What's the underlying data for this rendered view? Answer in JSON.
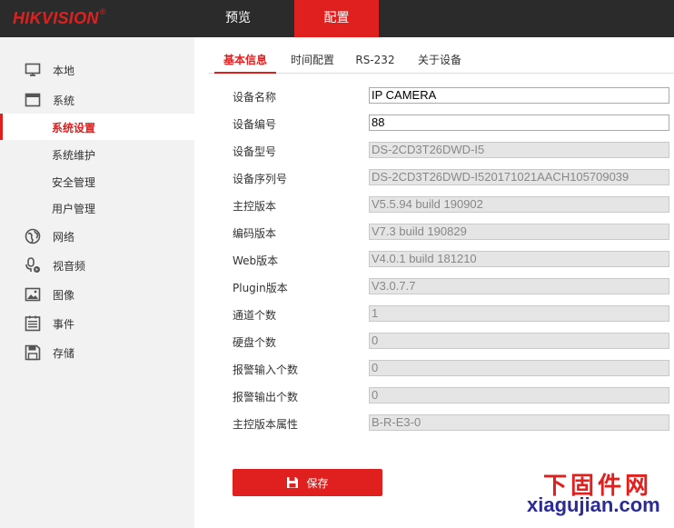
{
  "header": {
    "logo_text": "HIKVISION",
    "logo_reg": "®",
    "tabs": [
      {
        "label": "预览",
        "active": false
      },
      {
        "label": "配置",
        "active": true
      }
    ]
  },
  "sidebar": {
    "items": [
      {
        "label": "本地",
        "icon": "monitor-icon"
      },
      {
        "label": "系统",
        "icon": "window-icon"
      },
      {
        "label": "网络",
        "icon": "globe-icon"
      },
      {
        "label": "视音频",
        "icon": "microphone-icon"
      },
      {
        "label": "图像",
        "icon": "image-icon"
      },
      {
        "label": "事件",
        "icon": "list-icon"
      },
      {
        "label": "存储",
        "icon": "floppy-icon"
      }
    ],
    "system_subitems": [
      {
        "label": "系统设置",
        "active": true
      },
      {
        "label": "系统维护",
        "active": false
      },
      {
        "label": "安全管理",
        "active": false
      },
      {
        "label": "用户管理",
        "active": false
      }
    ]
  },
  "subtabs": [
    {
      "label": "基本信息",
      "active": true
    },
    {
      "label": "时间配置",
      "active": false
    },
    {
      "label": "RS-232",
      "active": false
    },
    {
      "label": "关于设备",
      "active": false
    }
  ],
  "form": {
    "fields": [
      {
        "label": "设备名称",
        "value": "IP CAMERA",
        "editable": true
      },
      {
        "label": "设备编号",
        "value": "88",
        "editable": true
      },
      {
        "label": "设备型号",
        "value": "DS-2CD3T26DWD-I5",
        "editable": false
      },
      {
        "label": "设备序列号",
        "value": "DS-2CD3T26DWD-I520171021AACH105709039",
        "editable": false
      },
      {
        "label": "主控版本",
        "value": "V5.5.94 build 190902",
        "editable": false
      },
      {
        "label": "编码版本",
        "value": "V7.3 build 190829",
        "editable": false
      },
      {
        "label": "Web版本",
        "value": "V4.0.1 build 181210",
        "editable": false
      },
      {
        "label": "Plugin版本",
        "value": "V3.0.7.7",
        "editable": false
      },
      {
        "label": "通道个数",
        "value": "1",
        "editable": false
      },
      {
        "label": "硬盘个数",
        "value": "0",
        "editable": false
      },
      {
        "label": "报警输入个数",
        "value": "0",
        "editable": false
      },
      {
        "label": "报警输出个数",
        "value": "0",
        "editable": false
      },
      {
        "label": "主控版本属性",
        "value": "B-R-E3-0",
        "editable": false
      }
    ],
    "save_label": "保存"
  },
  "watermark": {
    "line1": "下固件网",
    "line2": "xiagujian.com"
  }
}
